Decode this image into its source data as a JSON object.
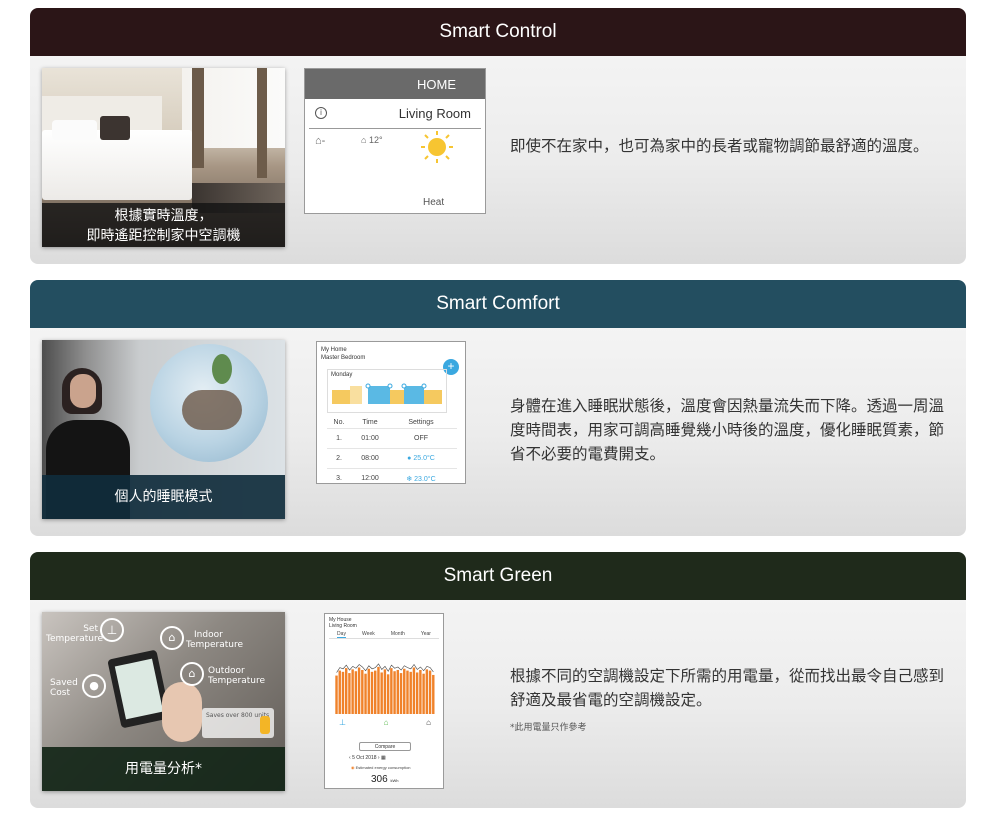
{
  "sections": {
    "control": {
      "title": "Smart Control",
      "photo_caption_1": "根據實時溫度，",
      "photo_caption_2": "即時遙距控制家中空調機",
      "phone": {
        "home": "HOME",
        "room": "Living Room",
        "temp": "12°",
        "mode": "Heat"
      },
      "description": "即使不在家中，也可為家中的長者或寵物調節最舒適的溫度。"
    },
    "comfort": {
      "title": "Smart Comfort",
      "photo_caption": "個人的睡眠模式",
      "phone": {
        "home": "My Home",
        "room": "Master Bedroom",
        "day": "Monday",
        "col_no": "No.",
        "col_time": "Time",
        "col_settings": "Settings",
        "rows": [
          {
            "no": "1.",
            "time": "01:00",
            "setting": "OFF"
          },
          {
            "no": "2.",
            "time": "08:00",
            "setting": "25.0°C"
          },
          {
            "no": "3.",
            "time": "12:00",
            "setting": "23.0°C"
          }
        ]
      },
      "description": "身體在進入睡眠狀態後，溫度會因熱量流失而下降。透過一周溫度時間表，用家可調高睡覺幾小時後的溫度，優化睡眠質素，節省不必要的電費開支。"
    },
    "green": {
      "title": "Smart Green",
      "photo_caption": "用電量分析*",
      "labels": {
        "set_temp_1": "Set",
        "set_temp_2": "Temperature",
        "indoor_1": "Indoor",
        "indoor_2": "Temperature",
        "outdoor_1": "Outdoor",
        "outdoor_2": "Temperature",
        "saved_1": "Saved",
        "saved_2": "Cost",
        "saves": "Saves over 800 units"
      },
      "phone": {
        "home": "My House",
        "room": "Living Room",
        "tabs": [
          "Day",
          "Week",
          "Month",
          "Year"
        ],
        "compare": "Compare",
        "date": "5 Oct 2018",
        "estimated": "Estimated energy consumption",
        "value": "306",
        "unit": "kWh"
      },
      "description": "根據不同的空調機設定下所需的用電量，從而找出最令自己感到舒適及最省電的空調機設定。",
      "note": "*此用電量只作參考"
    }
  },
  "colors": {
    "control_header": "#2b1517",
    "comfort_header": "#234e60",
    "green_header": "#1f2a1b",
    "accent_orange": "#f0822a",
    "accent_blue": "#3aa8e0"
  },
  "chart_data": {
    "type": "bar",
    "categories": [],
    "values": [
      62,
      70,
      68,
      74,
      66,
      72,
      69,
      75,
      71,
      65,
      73,
      68,
      70,
      76,
      67,
      72,
      64,
      74,
      69,
      71,
      66,
      73,
      70,
      68,
      75,
      67,
      71,
      65,
      72,
      70,
      63
    ],
    "title": "",
    "xlabel": "",
    "ylabel": "",
    "ylim": [
      0,
      100
    ]
  }
}
